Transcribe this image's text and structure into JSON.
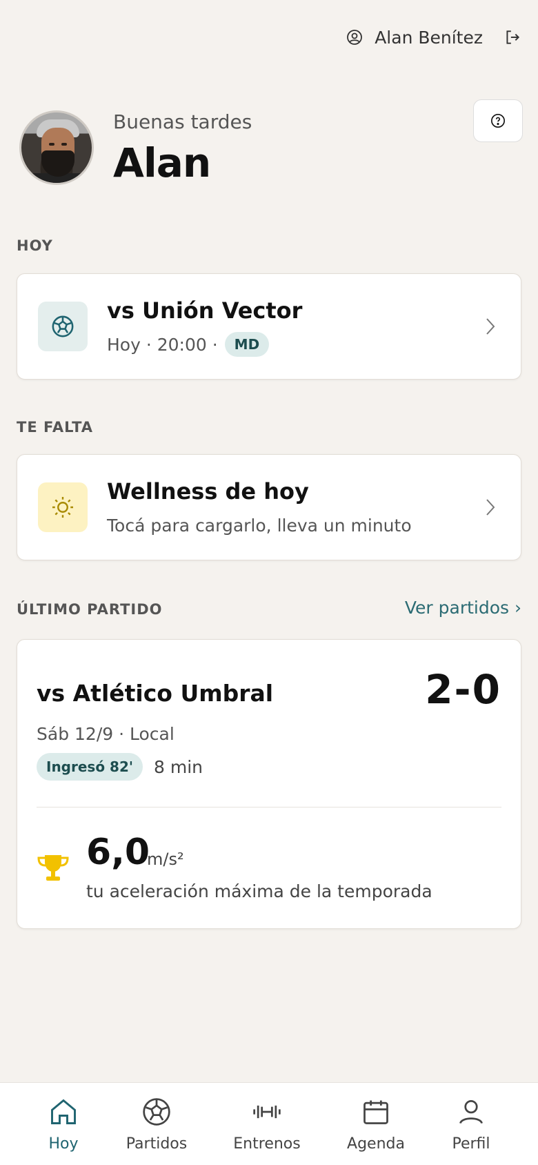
{
  "topbar": {
    "user_name": "Alan Benítez"
  },
  "greeting": {
    "subtitle": "Buenas tardes",
    "name": "Alan"
  },
  "today": {
    "section_label": "HOY",
    "match_title": "vs Unión Vector",
    "match_time": "Hoy · 20:00 ·",
    "badge": "MD"
  },
  "pending": {
    "section_label": "TE FALTA",
    "title": "Wellness de hoy",
    "subtitle": "Tocá para cargarlo, lleva un minuto"
  },
  "last_match": {
    "section_label": "ÚLTIMO PARTIDO",
    "link": "Ver partidos ›",
    "title": "vs Atlético Umbral",
    "score": "2-0",
    "subtitle": "Sáb 12/9 · Local",
    "entered_badge": "Ingresó 82'",
    "minutes": "8 min",
    "stat_value": "6,0",
    "stat_unit": "m/s²",
    "stat_desc": "tu aceleración máxima de la temporada"
  },
  "nav": {
    "items": [
      {
        "label": "Hoy",
        "icon": "home-icon",
        "active": true
      },
      {
        "label": "Partidos",
        "icon": "soccer-ball-icon"
      },
      {
        "label": "Entrenos",
        "icon": "dumbbell-icon"
      },
      {
        "label": "Agenda",
        "icon": "calendar-icon"
      },
      {
        "label": "Perfil",
        "icon": "user-icon"
      }
    ]
  },
  "colors": {
    "accent": "#1f6470",
    "badge_bg": "#dcebea",
    "sun_bg": "#fdf2c2",
    "ball_bg": "#e4eeed",
    "trophy": "#f2c100"
  }
}
